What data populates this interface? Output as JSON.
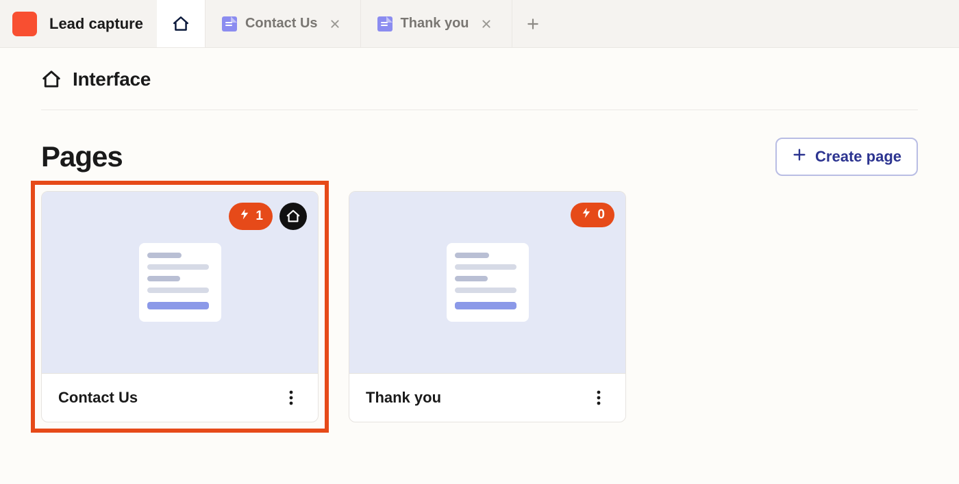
{
  "project": {
    "name": "Lead capture",
    "color": "#f84f31"
  },
  "tabs": [
    {
      "kind": "home",
      "active": true
    },
    {
      "kind": "page",
      "label": "Contact Us",
      "active": false
    },
    {
      "kind": "page",
      "label": "Thank you",
      "active": false
    }
  ],
  "heading": "Interface",
  "pages_section": {
    "title": "Pages",
    "create_label": "Create page"
  },
  "pages": [
    {
      "title": "Contact Us",
      "automations": 1,
      "is_home": true,
      "highlighted": true
    },
    {
      "title": "Thank you",
      "automations": 0,
      "is_home": false,
      "highlighted": false
    }
  ]
}
